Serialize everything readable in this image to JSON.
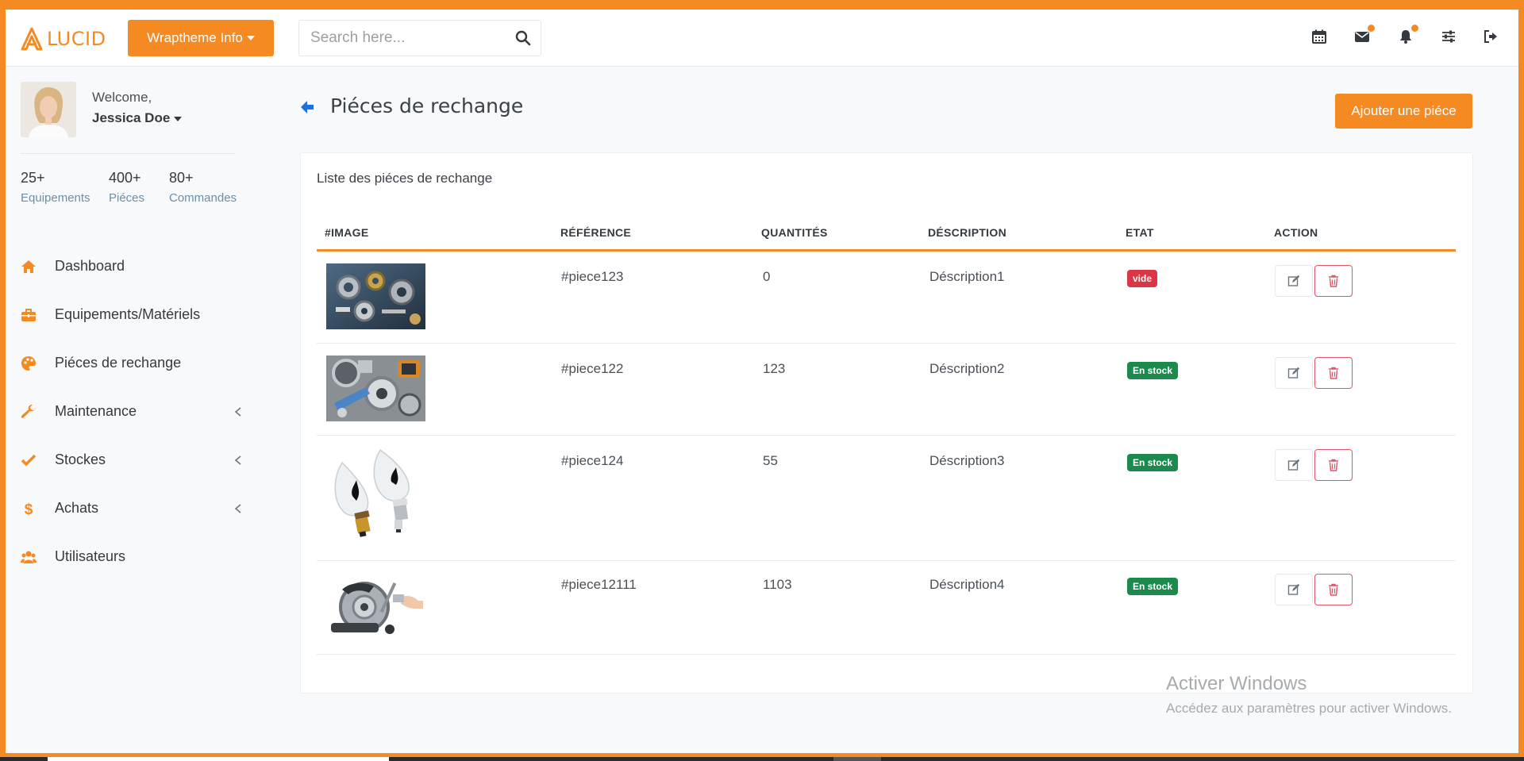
{
  "brand": {
    "name": "LUCID",
    "color": "#f68a22"
  },
  "topnav": {
    "dropdown_label": "Wraptheme Info",
    "search_placeholder": "Search here...",
    "icons": [
      "calendar-icon",
      "envelope-icon",
      "bell-icon",
      "sliders-icon",
      "sign-out-icon"
    ]
  },
  "user": {
    "welcome": "Welcome,",
    "name": "Jessica Doe"
  },
  "stats": [
    {
      "value": "25+",
      "label": "Equipements"
    },
    {
      "value": "400+",
      "label": "Piéces"
    },
    {
      "value": "80+",
      "label": "Commandes"
    }
  ],
  "menu": [
    {
      "label": "Dashboard",
      "icon": "home-icon",
      "has_children": false
    },
    {
      "label": "Equipements/Matériels",
      "icon": "briefcase-icon",
      "has_children": false
    },
    {
      "label": "Piéces de rechange",
      "icon": "palette-icon",
      "has_children": false
    },
    {
      "label": "Maintenance",
      "icon": "wrench-icon",
      "has_children": true
    },
    {
      "label": "Stockes",
      "icon": "check-icon",
      "has_children": true
    },
    {
      "label": "Achats",
      "icon": "dollar-icon",
      "has_children": true
    },
    {
      "label": "Utilisateurs",
      "icon": "users-icon",
      "has_children": false
    }
  ],
  "page": {
    "title": "Piéces de rechange",
    "add_button": "Ajouter une piéce",
    "card_title": "Liste des piéces de rechange"
  },
  "table": {
    "headers": [
      "#IMAGE",
      "RÉFÉRENCE",
      "QUANTITÉS",
      "DÉSCRIPTION",
      "ETAT",
      "ACTION"
    ],
    "rows": [
      {
        "image": "bearings-image",
        "reference": "#piece123",
        "quantity": "0",
        "description": "Déscription1",
        "status": "vide",
        "status_color": "#dc3545"
      },
      {
        "image": "engine-parts-image",
        "reference": "#piece122",
        "quantity": "123",
        "description": "Déscription2",
        "status": "En stock",
        "status_color": "#1b8a4c"
      },
      {
        "image": "bulbs-image",
        "reference": "#piece124",
        "quantity": "55",
        "description": "Déscription3",
        "status": "En stock",
        "status_color": "#1b8a4c"
      },
      {
        "image": "brake-disc-image",
        "reference": "#piece12111",
        "quantity": "1103",
        "description": "Déscription4",
        "status": "En stock",
        "status_color": "#1b8a4c"
      }
    ]
  },
  "watermark": {
    "line1": "Activer Windows",
    "line2": "Accédez aux paramètres pour activer Windows."
  }
}
